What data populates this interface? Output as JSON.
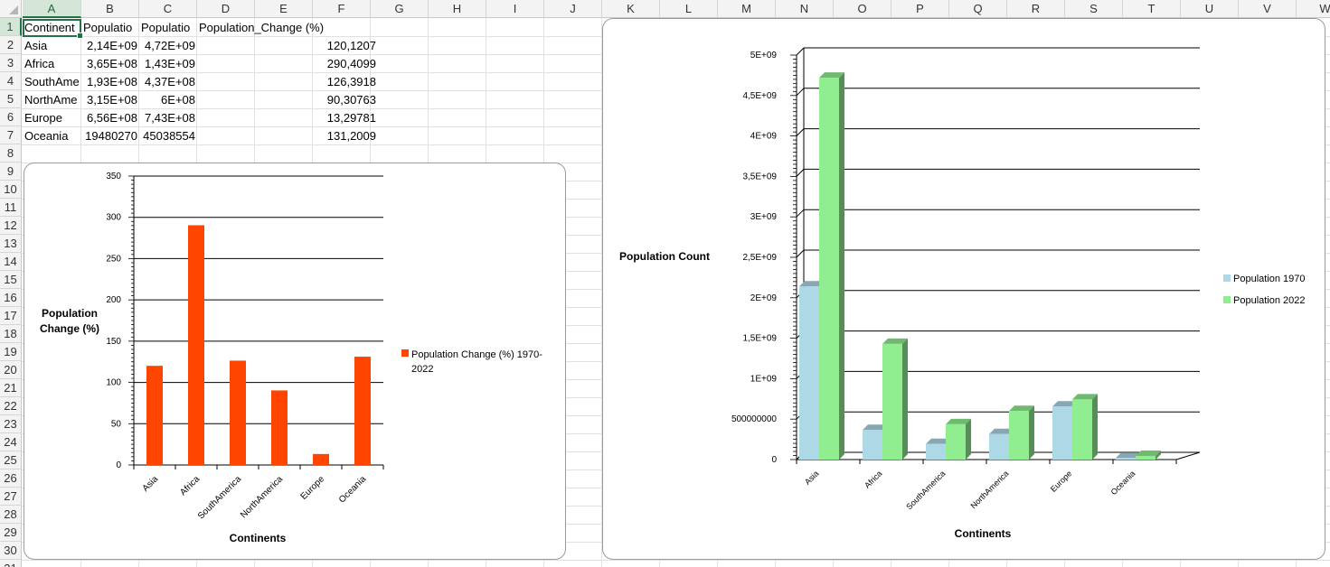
{
  "sheet": {
    "columns": [
      "A",
      "B",
      "C",
      "D",
      "E",
      "F",
      "G",
      "H",
      "I",
      "J",
      "K",
      "L",
      "M",
      "N",
      "O",
      "P",
      "Q",
      "R",
      "S",
      "T",
      "U",
      "V",
      "W"
    ],
    "rows": [
      "1",
      "2",
      "3",
      "4",
      "5",
      "6",
      "7",
      "8",
      "9",
      "10",
      "11",
      "12",
      "13",
      "14",
      "15",
      "16",
      "17",
      "18",
      "19",
      "20",
      "21",
      "22",
      "23",
      "24",
      "25",
      "26",
      "27",
      "28",
      "29",
      "30",
      "31"
    ],
    "selected_cell": "A1",
    "header_row": [
      "Continent",
      "Populatio",
      "Populatio",
      "Population_Change (%)"
    ],
    "data_rows": [
      [
        "Asia",
        "2,14E+09",
        "4,72E+09",
        "120,1207"
      ],
      [
        "Africa",
        "3,65E+08",
        "1,43E+09",
        "290,4099"
      ],
      [
        "SouthAme",
        "1,93E+08",
        "4,37E+08",
        "126,3918"
      ],
      [
        "NorthAme",
        "3,15E+08",
        "6E+08",
        "90,30763"
      ],
      [
        "Europe",
        "6,56E+08",
        "7,43E+08",
        "13,29781"
      ],
      [
        "Oceania",
        "19480270",
        "45038554",
        "131,2009"
      ]
    ]
  },
  "colors": {
    "change_bar": "#ff4500",
    "pop1970": "#add8e6",
    "pop2022": "#90ee90",
    "selection": "#217346"
  },
  "chart_data": [
    {
      "type": "bar",
      "categories": [
        "Asia",
        "Africa",
        "SouthAmerica",
        "NorthAmerica",
        "Europe",
        "Oceania"
      ],
      "series": [
        {
          "name": "Population Change (%) 1970-2022",
          "values": [
            120.12,
            290.41,
            126.39,
            90.31,
            13.3,
            131.2
          ]
        }
      ],
      "title": "",
      "xlabel": "Continents",
      "ylabel": "Population Change (%)",
      "ylim": [
        0,
        350
      ],
      "yticks": [
        "0",
        "50",
        "100",
        "150",
        "200",
        "250",
        "300",
        "350"
      ],
      "grid": true,
      "legend": "right"
    },
    {
      "type": "bar",
      "categories": [
        "Asia",
        "Africa",
        "SouthAmerica",
        "NorthAmerica",
        "Europe",
        "Oceania"
      ],
      "series": [
        {
          "name": "Population 1970",
          "values": [
            2140000000,
            365000000,
            193000000,
            315000000,
            656000000,
            19480270
          ]
        },
        {
          "name": "Population 2022",
          "values": [
            4720000000,
            1430000000,
            437000000,
            600000000,
            743000000,
            45038554
          ]
        }
      ],
      "title": "",
      "xlabel": "Continents",
      "ylabel": "Population Count",
      "ylim": [
        0,
        5000000000
      ],
      "yticks": [
        "0",
        "500000000",
        "1E+09",
        "1,5E+09",
        "2E+09",
        "2,5E+09",
        "3E+09",
        "3,5E+09",
        "4E+09",
        "4,5E+09",
        "5E+09"
      ],
      "grid": true,
      "legend": "right",
      "style": "3d"
    }
  ]
}
